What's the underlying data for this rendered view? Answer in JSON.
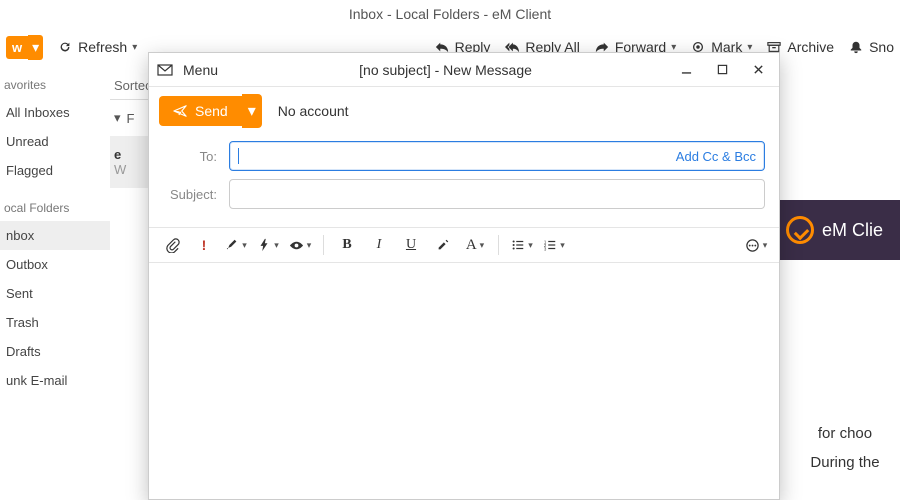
{
  "app": {
    "title": "Inbox - Local Folders - eM Client",
    "toolbar": {
      "new": "w",
      "refresh": "Refresh",
      "reply": "Reply",
      "reply_all": "Reply All",
      "forward": "Forward",
      "mark": "Mark",
      "archive": "Archive",
      "snooze": "Sno"
    }
  },
  "sidebar": {
    "favorites_heading": "avorites",
    "items": [
      {
        "label": "All Inboxes"
      },
      {
        "label": "Unread"
      },
      {
        "label": "Flagged"
      }
    ],
    "local_heading": "ocal Folders",
    "local_items": [
      {
        "label": "nbox",
        "active": true
      },
      {
        "label": "Outbox"
      },
      {
        "label": "Sent"
      },
      {
        "label": "Trash"
      },
      {
        "label": "Drafts"
      },
      {
        "label": "unk E-mail"
      }
    ]
  },
  "msglist": {
    "sorted": "Sortec",
    "row_expand": "▾",
    "row_flag": "F",
    "sender": "e",
    "preview": "W"
  },
  "brand": {
    "name": "eM Clie"
  },
  "bgtext": {
    "line1": "for choo",
    "line2": "During the"
  },
  "compose": {
    "menu": "Menu",
    "title": "[no subject] - New Message",
    "send": "Send",
    "no_account": "No account",
    "labels": {
      "to": "To:",
      "subject": "Subject:"
    },
    "add_cc": "Add Cc & Bcc",
    "fmt": {
      "A": "A",
      "B": "B",
      "I": "I",
      "U": "U",
      "excl": "!"
    }
  }
}
